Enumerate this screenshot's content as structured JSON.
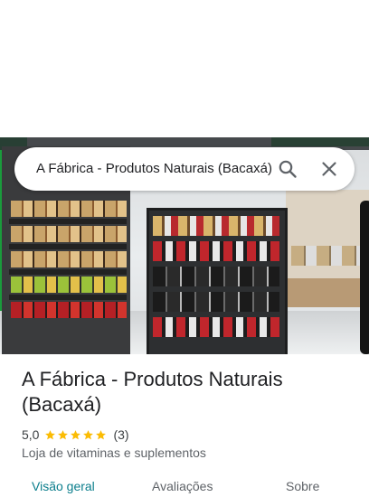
{
  "search": {
    "query": "A Fábrica - Produtos Naturais (Bacaxá)"
  },
  "place": {
    "title": "A Fábrica - Produtos Naturais (Bacaxá)",
    "rating": "5,0",
    "stars": 5,
    "review_count": "(3)",
    "category": "Loja de vitaminas e suplementos"
  },
  "tabs": [
    {
      "label": "Visão geral",
      "active": true
    },
    {
      "label": "Avaliações",
      "active": false
    },
    {
      "label": "Sobre",
      "active": false
    }
  ],
  "icons": {
    "search": "search-icon",
    "close": "close-icon",
    "star": "star-icon"
  },
  "colors": {
    "star": "#fbbc04",
    "active_tab": "#0b7e8c",
    "store_green": "#1a9b3c"
  }
}
